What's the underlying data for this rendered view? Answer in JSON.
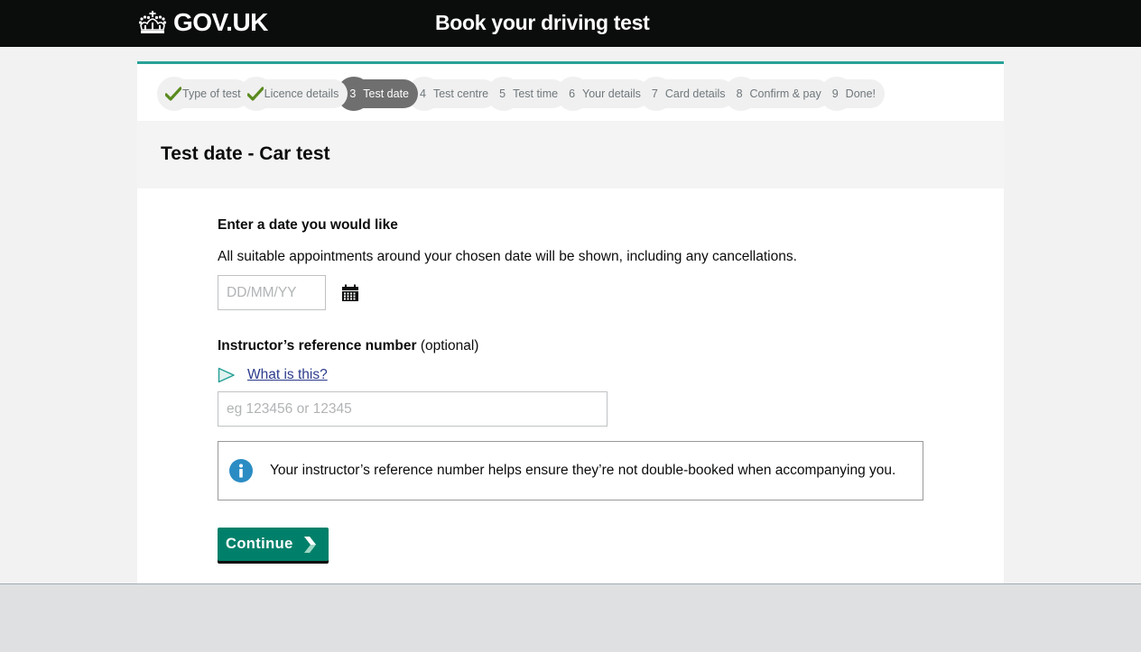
{
  "header": {
    "logo_text": "GOV.UK",
    "service_name": "Book your driving test"
  },
  "steps": [
    {
      "num": "",
      "label": "Type of test",
      "state": "complete"
    },
    {
      "num": "",
      "label": "Licence details",
      "state": "complete"
    },
    {
      "num": "3",
      "label": "Test date",
      "state": "active"
    },
    {
      "num": "4",
      "label": "Test centre",
      "state": "pending"
    },
    {
      "num": "5",
      "label": "Test time",
      "state": "pending"
    },
    {
      "num": "6",
      "label": "Your details",
      "state": "pending"
    },
    {
      "num": "7",
      "label": "Card details",
      "state": "pending"
    },
    {
      "num": "8",
      "label": "Confirm & pay",
      "state": "pending"
    },
    {
      "num": "9",
      "label": "Done!",
      "state": "pending"
    }
  ],
  "page_title": "Test date - Car test",
  "date_question": {
    "label": "Enter a date you would like",
    "hint": "All suitable appointments around your chosen date will be shown, including any cancellations.",
    "input_value": "",
    "input_placeholder": "DD/MM/YY",
    "calendar_icon": "calendar-icon"
  },
  "instructor": {
    "label_bold": "Instructor’s reference number",
    "label_suffix": " (optional)",
    "details_link": "What is this?",
    "input_value": "",
    "input_placeholder": "eg 123456 or 12345"
  },
  "info_box": {
    "icon": "info-icon",
    "text": "Your instructor’s reference number helps ensure they’re not double-booked when accompanying you."
  },
  "continue_button": {
    "label": "Continue"
  },
  "colors": {
    "header_bg": "#0b0c0c",
    "accent_teal": "#28a197",
    "button_green": "#00806a",
    "link": "#2b3a8c",
    "active_step": "#6f6f6f",
    "check_green": "#5a8a1e",
    "info_blue": "#2b8cc4"
  }
}
